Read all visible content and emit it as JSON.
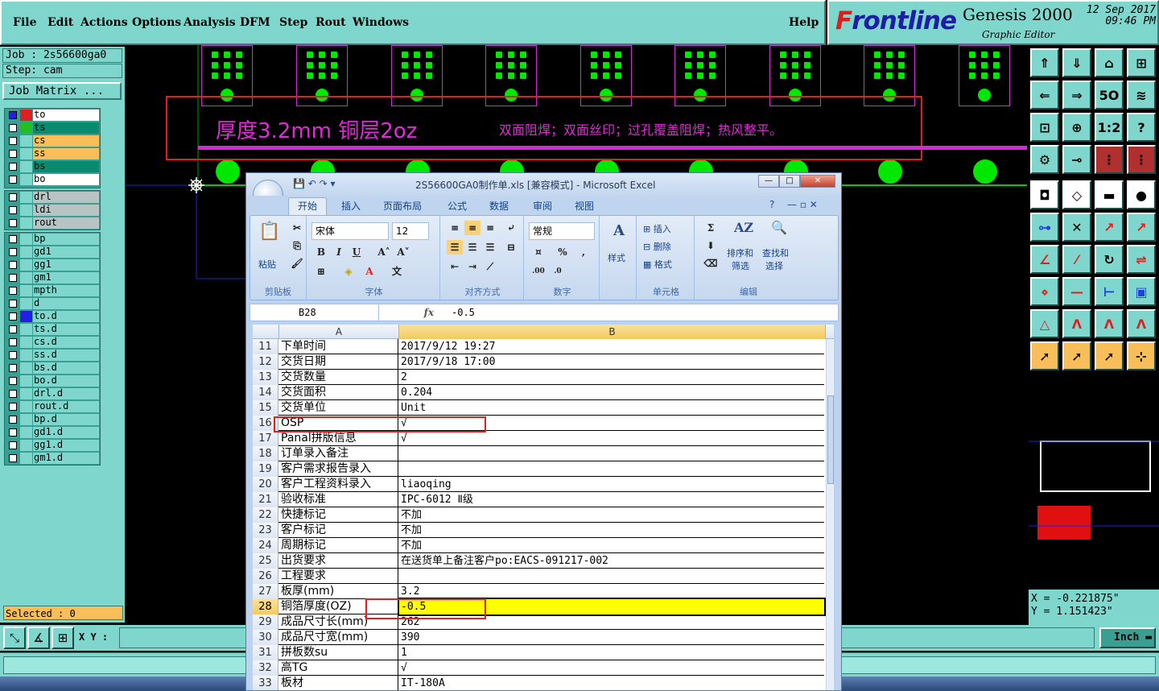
{
  "menu": {
    "items": [
      "File",
      "Edit",
      "Actions",
      "Options",
      "Analysis",
      "DFM",
      "Step",
      "Rout",
      "Windows"
    ],
    "help": "Help"
  },
  "logo": {
    "brand_a": "F",
    "brand_b": "rontline",
    "product": "Genesis 2000",
    "subtitle": "Graphic Editor",
    "date": "12 Sep 2017",
    "time": "09:46 PM"
  },
  "job": {
    "job_label": "Job : 2s56600ga0",
    "step_label": "Step: cam",
    "matrix_button": "Job Matrix ..."
  },
  "layers": {
    "group1": [
      {
        "name": "to",
        "color": "#e02020",
        "bg": "#ffffff"
      },
      {
        "name": "ts",
        "color": "#20c020",
        "bg": "#0a8a6e"
      },
      {
        "name": "cs",
        "color": "#7fd6cc",
        "bg": "#f7be5a"
      },
      {
        "name": "ss",
        "color": "#7fd6cc",
        "bg": "#f7be5a"
      },
      {
        "name": "bs",
        "color": "#7fd6cc",
        "bg": "#0a8a6e"
      },
      {
        "name": "bo",
        "color": "#7fd6cc",
        "bg": "#ffffff"
      }
    ],
    "group2": [
      {
        "name": "drl",
        "bg": "#b8c4c4"
      },
      {
        "name": "ldi",
        "bg": "#b8c4c4"
      },
      {
        "name": "rout",
        "bg": "#b8c4c4"
      }
    ],
    "group3": [
      {
        "name": "bp"
      },
      {
        "name": "gd1"
      },
      {
        "name": "gg1"
      },
      {
        "name": "gm1"
      },
      {
        "name": "mpth"
      },
      {
        "name": "d"
      },
      {
        "name": "to.d",
        "color": "#2020e0"
      },
      {
        "name": "ts.d"
      },
      {
        "name": "cs.d"
      },
      {
        "name": "ss.d"
      },
      {
        "name": "bs.d"
      },
      {
        "name": "bo.d"
      },
      {
        "name": "drl.d"
      },
      {
        "name": "rout.d"
      },
      {
        "name": "bp.d"
      },
      {
        "name": "gd1.d"
      },
      {
        "name": "gg1.d"
      },
      {
        "name": "gm1.d"
      }
    ]
  },
  "selected": "Selected : 0",
  "canvas": {
    "big_text": "厚度3.2mm  铜层2oz",
    "small_text": "双面阻焊；双面丝印；过孔覆盖阻焊；热风整平。"
  },
  "coords": {
    "x": "X = -0.221875\"",
    "y": "Y = 1.151423\""
  },
  "bottom": {
    "xy_label": "X Y :",
    "unit": "Inch"
  },
  "excel": {
    "title": "2S56600GA0制作单.xls  [兼容模式] - Microsoft Excel",
    "tabs": [
      "开始",
      "插入",
      "页面布局",
      "公式",
      "数据",
      "审阅",
      "视图"
    ],
    "ribbon": {
      "paste": "粘贴",
      "clipboard": "剪贴板",
      "font_name": "宋体",
      "font_size": "12",
      "font": "字体",
      "align": "对齐方式",
      "number_format": "常规",
      "number": "数字",
      "styles": "样式",
      "insert": "插入",
      "delete": "删除",
      "format": "格式",
      "cells": "单元格",
      "sort": "排序和",
      "filter": "筛选",
      "find": "查找和",
      "select": "选择",
      "edit": "编辑"
    },
    "name_box": "B28",
    "formula": "-0.5",
    "col_a": "A",
    "col_b": "B",
    "rows": [
      {
        "n": "11",
        "a": "下单时间",
        "b": "2017/9/12 19:27"
      },
      {
        "n": "12",
        "a": "交货日期",
        "b": "2017/9/18 17:00"
      },
      {
        "n": "13",
        "a": "交货数量",
        "b": "2"
      },
      {
        "n": "14",
        "a": "交货面积",
        "b": "0.204"
      },
      {
        "n": "15",
        "a": "交货单位",
        "b": "Unit"
      },
      {
        "n": "16",
        "a": "OSP",
        "b": "√"
      },
      {
        "n": "17",
        "a": "Panal拼版信息",
        "b": "√"
      },
      {
        "n": "18",
        "a": "订单录入备注",
        "b": ""
      },
      {
        "n": "19",
        "a": "客户需求报告录入",
        "b": ""
      },
      {
        "n": "20",
        "a": "客户工程资料录入",
        "b": "liaoqing"
      },
      {
        "n": "21",
        "a": "验收标准",
        "b": "IPC-6012 Ⅱ级"
      },
      {
        "n": "22",
        "a": "快捷标记",
        "b": "不加"
      },
      {
        "n": "23",
        "a": "客户标记",
        "b": "不加"
      },
      {
        "n": "24",
        "a": "周期标记",
        "b": "不加"
      },
      {
        "n": "25",
        "a": "出货要求",
        "b": "在送货单上备注客户po:EACS-091217-002"
      },
      {
        "n": "26",
        "a": "工程要求",
        "b": ""
      },
      {
        "n": "27",
        "a": "板厚(mm)",
        "b": "3.2"
      },
      {
        "n": "28",
        "a": "铜箔厚度(OZ)",
        "b": "-0.5"
      },
      {
        "n": "29",
        "a": "成品尺寸长(mm)",
        "b": "262"
      },
      {
        "n": "30",
        "a": "成品尺寸宽(mm)",
        "b": "390"
      },
      {
        "n": "31",
        "a": "拼板数su",
        "b": "1"
      },
      {
        "n": "32",
        "a": "高TG",
        "b": "√"
      },
      {
        "n": "33",
        "a": "板材",
        "b": "IT-180A"
      }
    ]
  }
}
